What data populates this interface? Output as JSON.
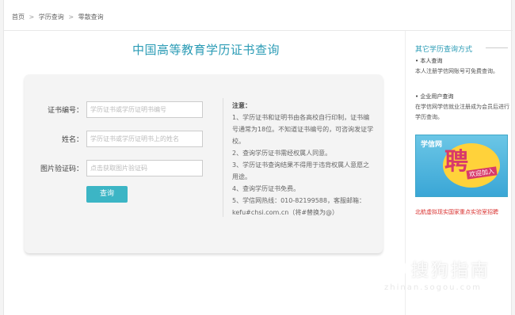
{
  "breadcrumb": {
    "home": "首页",
    "sep": ">",
    "level1": "学历查询",
    "level2": "零散查询"
  },
  "main": {
    "title": "中国高等教育学历证书查询"
  },
  "form": {
    "cert_label": "证书编号：",
    "cert_placeholder": "学历证书或学历证明书编号",
    "name_label": "姓名：",
    "name_placeholder": "学历证书或学历证明书上的姓名",
    "captcha_label": "图片验证码：",
    "captcha_placeholder": "点击获取图片验证码",
    "submit_label": "查询"
  },
  "notes": {
    "title": "注意：",
    "items": [
      "1、学历证书和证明书由各高校自行印制，证书编号通常为18位。不知道证书编号的，可咨询发证学校。",
      "2、查询学历证书需经权属人同意。",
      "3、学历证书查询结果不得用于违背权属人意愿之用途。",
      "4、查询学历证书免费。",
      "5、学信网热线：010-82199588，客服邮箱：kefu#chsi.com.cn（将#替换为@）"
    ]
  },
  "sidebar": {
    "title": "其它学历查询方式",
    "personal": {
      "head": "• 本人查询",
      "desc": "本人注册学信网账号可免费查询。"
    },
    "enterprise": {
      "head": "• 企业用户查询",
      "desc": "在学信网学信就业注册成为会员后进行学历查询。"
    },
    "banner": {
      "logo": "学信网",
      "big": "聘",
      "small": "欢迎加入"
    },
    "link": "北航虚拟现实国家重点实验室招聘"
  },
  "watermark": {
    "cn": "搜狗指南",
    "en": "zhinan.sogou.com"
  },
  "colors": {
    "accent": "#2a9bb5",
    "button": "#3cb5c5",
    "link_red": "#d9312f"
  }
}
